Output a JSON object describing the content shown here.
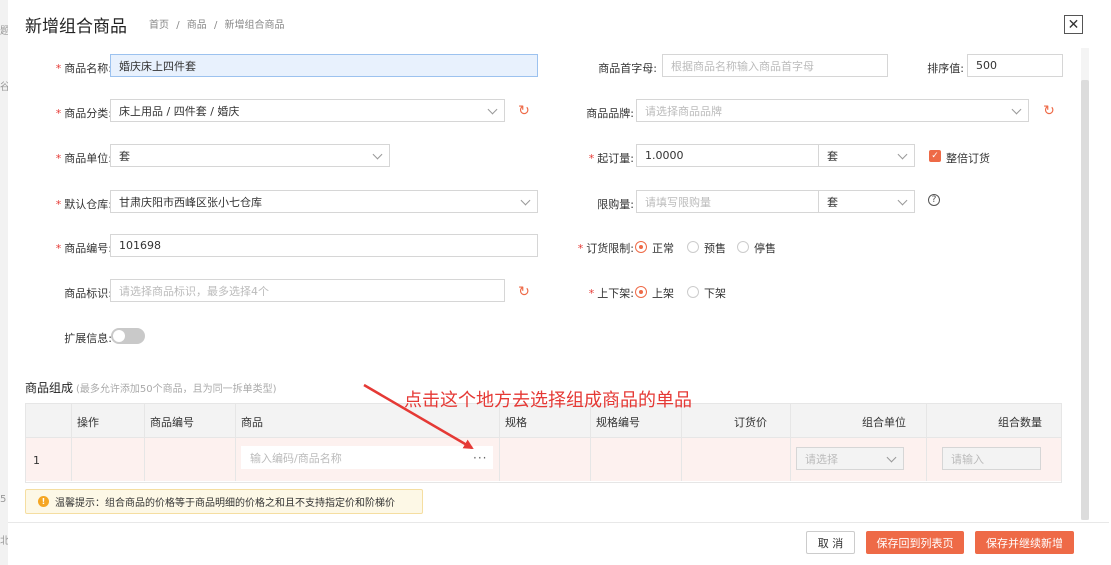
{
  "bg_fragments": [
    "题",
    "谷",
    "5",
    "北"
  ],
  "dialog": {
    "title": "新增组合商品",
    "breadcrumb": [
      "首页",
      "/",
      "商品",
      "/",
      "新增组合商品"
    ]
  },
  "form": {
    "name": {
      "label": "商品名称:",
      "required": true,
      "value": "婚庆床上四件套"
    },
    "initial": {
      "label": "商品首字母:",
      "placeholder": "根据商品名称输入商品首字母"
    },
    "sort": {
      "label": "排序值:",
      "value": "500"
    },
    "category": {
      "label": "商品分类:",
      "required": true,
      "value": "床上用品 / 四件套 / 婚庆"
    },
    "brand": {
      "label": "商品品牌:",
      "placeholder": "请选择商品品牌"
    },
    "unit": {
      "label": "商品单位:",
      "required": true,
      "value": "套"
    },
    "min_order": {
      "label": "起订量:",
      "required": true,
      "value": "1.0000",
      "unit": "套",
      "multiple_label": "整倍订货",
      "multiple_checked": true
    },
    "warehouse": {
      "label": "默认仓库:",
      "required": true,
      "value": "甘肃庆阳市西峰区张小七仓库"
    },
    "limit": {
      "label": "限购量:",
      "placeholder": "请填写限购量",
      "unit": "套",
      "help": "?"
    },
    "code": {
      "label": "商品编号:",
      "required": true,
      "value": "101698"
    },
    "order_limit": {
      "label": "订货限制:",
      "required": true,
      "options": [
        "正常",
        "预售",
        "停售"
      ],
      "selected": 0
    },
    "tags": {
      "label": "商品标识:",
      "placeholder": "请选择商品标识，最多选择4个"
    },
    "shelf": {
      "label": "上下架:",
      "required": true,
      "options": [
        "上架",
        "下架"
      ],
      "selected": 0
    },
    "extra": {
      "label": "扩展信息:",
      "enabled": false
    }
  },
  "composition": {
    "title": "商品组成",
    "hint": "(最多允许添加50个商品，且为同一拆单类型)",
    "headers": [
      "操作",
      "商品编号",
      "商品",
      "规格",
      "规格编号",
      "订货价",
      "组合单位",
      "组合数量"
    ],
    "rows": [
      {
        "index": "1",
        "product_placeholder": "输入编码/商品名称",
        "more": "···",
        "unit_placeholder": "请选择",
        "qty_placeholder": "请输入"
      }
    ]
  },
  "tip": {
    "icon": "!",
    "text": "温馨提示：组合商品的价格等于商品明细的价格之和且不支持指定价和阶梯价"
  },
  "annotation": {
    "text": "点击这个地方去选择组成商品的单品",
    "color": "#e53935"
  },
  "footer": {
    "cancel": "取 消",
    "save_back": "保存回到列表页",
    "save_continue": "保存并继续新增"
  },
  "colors": {
    "accent": "#ee6a47",
    "required": "#e53935"
  }
}
